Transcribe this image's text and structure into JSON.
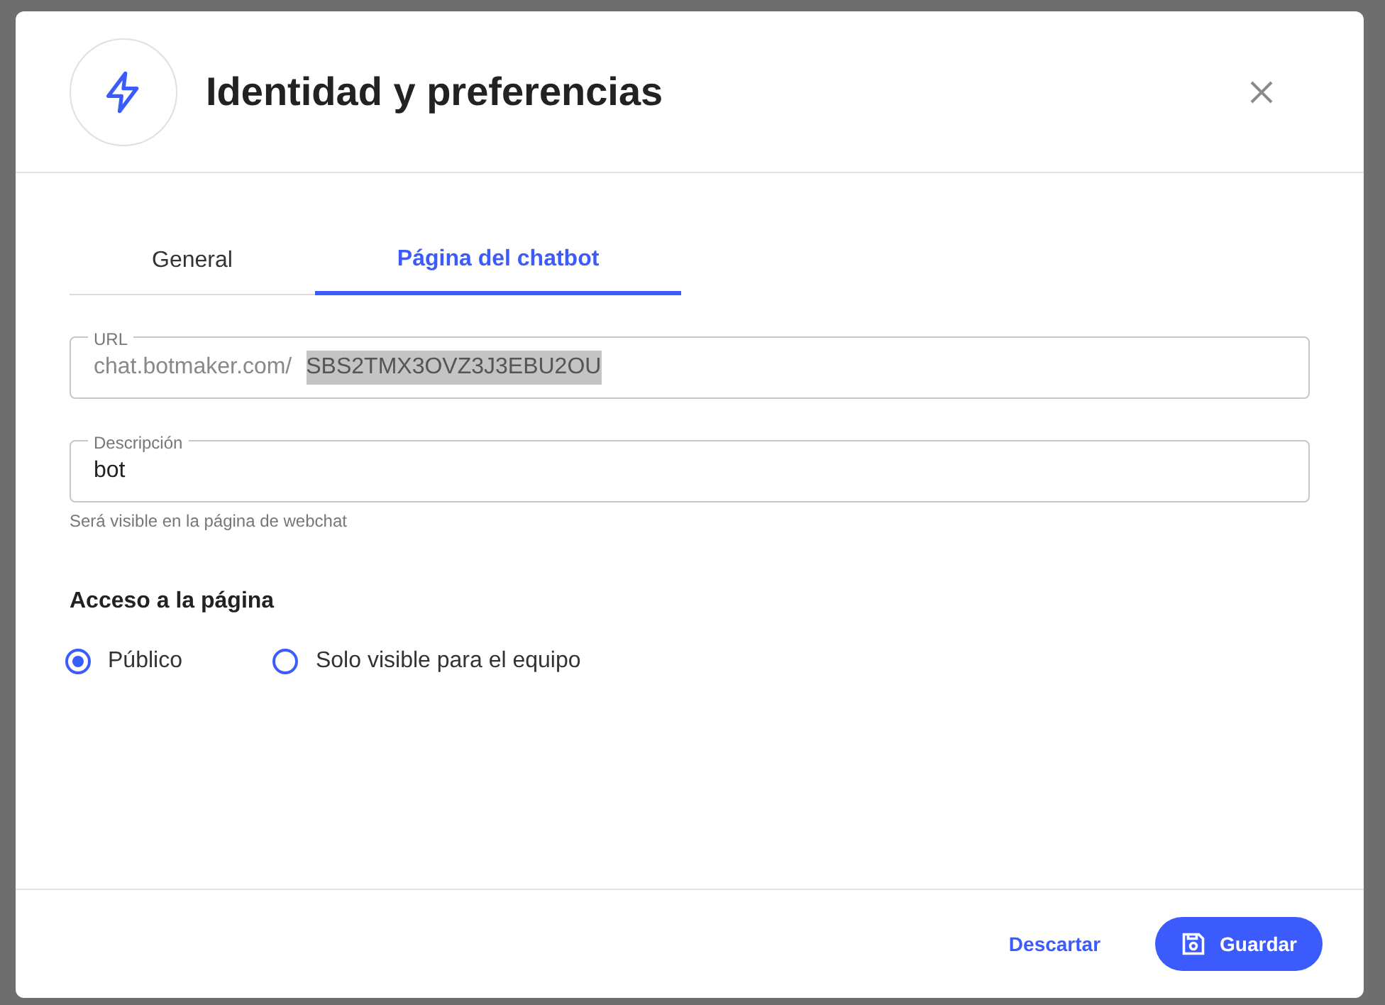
{
  "dialog": {
    "title": "Identidad y preferencias",
    "tabs": [
      {
        "label": "General",
        "selected": false
      },
      {
        "label": "Página del chatbot",
        "selected": true
      }
    ],
    "url_field": {
      "label": "URL",
      "prefix": "chat.botmaker.com/",
      "value": "SBS2TMX3OVZ3J3EBU2OU",
      "highlighted": true
    },
    "description_field": {
      "label": "Descripción",
      "value": "bot",
      "helper": "Será visible en la página de webchat"
    },
    "access": {
      "heading": "Acceso a la página",
      "options": [
        {
          "label": "Público",
          "selected": true
        },
        {
          "label": "Solo visible para el equipo",
          "selected": false
        }
      ]
    },
    "buttons": [
      {
        "label": "Descartar",
        "kind": "text"
      },
      {
        "label": "Guardar",
        "kind": "primary"
      }
    ]
  }
}
